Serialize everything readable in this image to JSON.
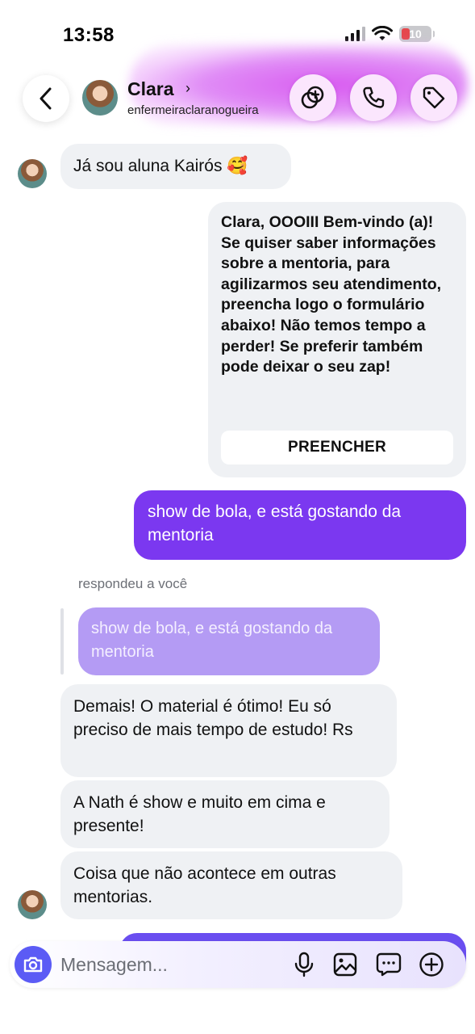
{
  "status_bar": {
    "time": "13:58",
    "battery": "10"
  },
  "header": {
    "name": "Clara",
    "chevron": "›",
    "username": "enfermeiraclaranogueira",
    "actions": [
      "sticker-icon",
      "phone-icon",
      "tag-icon"
    ]
  },
  "messages": {
    "m1": "Já sou aluna Kairós 🥰",
    "card": {
      "text": "Clara, OOOIII Bem-vindo (a)! Se quiser saber informações sobre a mentoria, para agilizarmos seu atendimento, preencha logo o formulário abaixo! Não temos tempo a perder!  Se preferir também pode deixar o seu zap!",
      "button": "PREENCHER"
    },
    "sent1": "show de bola, e está gostando da mentoria",
    "reply_label": "respondeu a você",
    "reply_quote": "show de bola, e está gostando da mentoria",
    "m2": "Demais! O material é ótimo! Eu só preciso de mais tempo de estudo! Rs",
    "m3": "A Nath é show e muito em cima e presente!",
    "m4": "Coisa que não acontece em outras mentorias."
  },
  "composer": {
    "placeholder": "Mensagem...",
    "icons": [
      "camera-icon",
      "microphone-icon",
      "gallery-icon",
      "chat-icon",
      "plus-icon"
    ]
  },
  "colors": {
    "accent": "#7b38f0",
    "incoming_bubble": "#eff1f4",
    "quoted_bubble": "#b49bf4"
  }
}
